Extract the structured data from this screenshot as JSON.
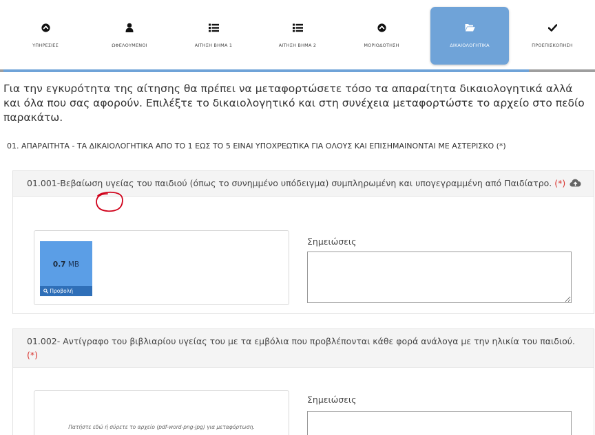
{
  "steps": [
    {
      "label": "ΥΠΗΡΕΣΙΕΣ",
      "icon": "arrow-circle-up-icon"
    },
    {
      "label": "ΩΦΕΛΟΥΜΕΝΟΙ",
      "icon": "user-icon"
    },
    {
      "label": "ΑΙΤΗΣΗ ΒΗΜΑ 1",
      "icon": "list-icon"
    },
    {
      "label": "ΑΙΤΗΣΗ ΒΗΜΑ 2",
      "icon": "list-icon"
    },
    {
      "label": "ΜΟΡΙΟΔΟΤΗΣΗ",
      "icon": "arrow-circle-up-icon"
    },
    {
      "label": "ΔΙΚΑΙΟΛΟΓΗΤΙΚΑ",
      "icon": "folder-open-icon",
      "active": true
    },
    {
      "label": "ΠΡΟΕΠΙΣΚΟΠΗΣΗ",
      "icon": "check-icon"
    }
  ],
  "progress": {
    "completed_fraction": 0.888
  },
  "colors": {
    "accent": "#6fa3d8",
    "required": "#d9332e",
    "thumb": "#5b9ee6",
    "thumb_bar": "#2f6fb8",
    "annotation": "#d0021b"
  },
  "intro_text": "Για την εγκυρότητα της αίτησης θα πρέπει να μεταφορτώσετε τόσο τα απαραίτητα δικαιολογητικά αλλά και όλα που σας αφορούν. Επιλέξτε το δικαιολογητικό και στη συνέχεια μεταφορτώστε το αρχείο στο πεδίο παρακάτω.",
  "section_title": "01. ΑΠΑΡΑΙΤΗΤΑ - ΤΑ ΔΙΚΑΙΟΛΟΓΗΤΙΚΑ ΑΠΟ ΤΟ 1 ΕΩΣ ΤΟ 5 ΕΙΝΑΙ ΥΠΟΧΡΕΩΤΙΚΑ ΓΙΑ ΟΛΟΥΣ ΚΑΙ ΕΠΙΣΗΜΑΙΝΟΝΤΑΙ ΜΕ ΑΣΤΕΡΙΣΚΟ (*)",
  "documents": [
    {
      "title": "01.001-Βεβαίωση υγείας του παιδιού (όπως το συνημμένο υπόδειγμα) συμπληρωμένη και υπογεγραμμένη από Παιδίατρο.",
      "required_mark": "(*)",
      "file_size_value": "0.7",
      "file_size_unit": "MB",
      "view_label": "Προβολή",
      "notes_label": "Σημειώσεις",
      "notes_value": ""
    },
    {
      "title": "01.002- Αντίγραφο του βιβλιαρίου υγείας του με τα εμβόλια που προβλέπονται κάθε φορά ανάλογα με την ηλικία του παιδιού.",
      "required_mark": "(*)",
      "dropzone_text": "Πατήστε εδώ ή σύρετε το αρχείο (pdf-word-png-jpg) για μεταφόρτωση.",
      "notes_label": "Σημειώσεις",
      "notes_value": ""
    }
  ]
}
